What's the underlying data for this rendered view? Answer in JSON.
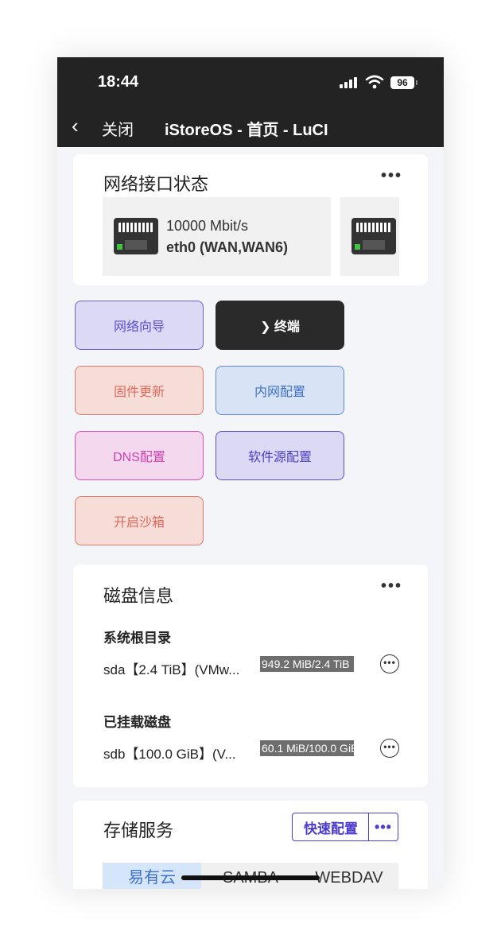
{
  "status_bar": {
    "time": "18:44",
    "battery": "96"
  },
  "nav": {
    "back_label": "关闭",
    "title": "iStoreOS - 首页 - LuCI"
  },
  "network_card": {
    "title": "网络接口状态",
    "interfaces": [
      {
        "speed": "10000 Mbit/s",
        "name": "eth0 (WAN,WAN6)"
      }
    ]
  },
  "quick_actions": [
    {
      "label": "网络向导"
    },
    {
      "label": "❯ 终端"
    },
    {
      "label": "固件更新"
    },
    {
      "label": "内网配置"
    },
    {
      "label": "DNS配置"
    },
    {
      "label": "软件源配置"
    },
    {
      "label": "开启沙箱"
    }
  ],
  "disk_card": {
    "title": "磁盘信息",
    "root": {
      "label": "系统根目录",
      "desc": "sda【2.4 TiB】(VMw...",
      "usage": "949.2 MiB/2.4 TiB"
    },
    "mounted": {
      "label": "已挂载磁盘",
      "desc": "sdb【100.0 GiB】(V...",
      "usage": "60.1 MiB/100.0 GiB"
    }
  },
  "storage_card": {
    "title": "存储服务",
    "quick_config": "快速配置",
    "tabs": [
      "易有云",
      "SAMBA",
      "WEBDAV"
    ]
  }
}
